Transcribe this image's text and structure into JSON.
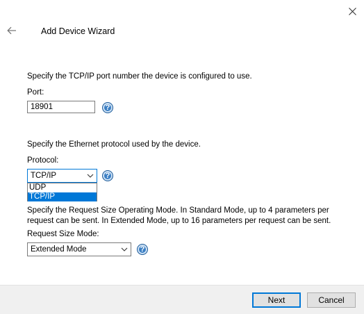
{
  "window": {
    "title": "Add Device Wizard"
  },
  "port_section": {
    "description": "Specify the TCP/IP port number the device is configured to use.",
    "label": "Port:",
    "value": "18901"
  },
  "protocol_section": {
    "description": "Specify the Ethernet protocol used by the device.",
    "label": "Protocol:",
    "selected": "TCP/IP",
    "options": [
      "UDP",
      "TCP/IP"
    ],
    "highlighted_option": "TCP/IP"
  },
  "request_section": {
    "description_line1": "Specify the Request Size Operating Mode. In Standard Mode, up to 4 parameters per",
    "description_line2": "request can be sent. In Extended Mode, up to 16 parameters per request can be sent.",
    "label": "Request Size Mode:",
    "selected": "Extended Mode"
  },
  "help_glyph": "?",
  "buttons": {
    "next": "Next",
    "cancel": "Cancel"
  },
  "colors": {
    "accent": "#0078d7",
    "help_icon": "#3b7fc4"
  }
}
